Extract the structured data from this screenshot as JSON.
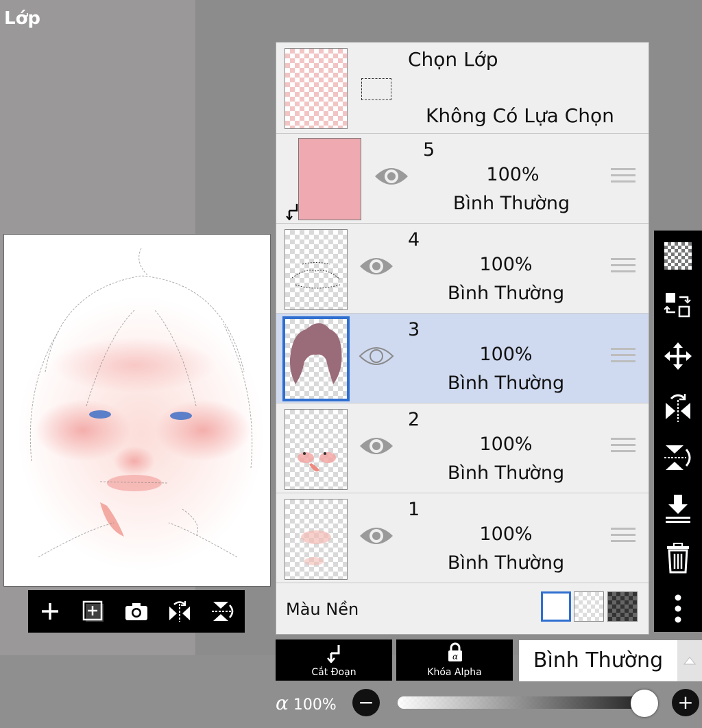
{
  "panel_title": "Lớp",
  "selection": {
    "title": "Chọn Lớp",
    "status": "Không Có Lựa Chọn"
  },
  "layers": [
    {
      "number": "5",
      "opacity": "100%",
      "blend": "Bình Thường",
      "clipped": true,
      "visible": true,
      "selected": false
    },
    {
      "number": "4",
      "opacity": "100%",
      "blend": "Bình Thường",
      "clipped": false,
      "visible": true,
      "selected": false
    },
    {
      "number": "3",
      "opacity": "100%",
      "blend": "Bình Thường",
      "clipped": false,
      "visible": false,
      "selected": true
    },
    {
      "number": "2",
      "opacity": "100%",
      "blend": "Bình Thường",
      "clipped": false,
      "visible": true,
      "selected": false
    },
    {
      "number": "1",
      "opacity": "100%",
      "blend": "Bình Thường",
      "clipped": false,
      "visible": true,
      "selected": false
    }
  ],
  "background": {
    "label": "Màu Nền",
    "options": [
      "white",
      "transparent",
      "dark-checker"
    ],
    "selected": "white"
  },
  "bottom_bar": {
    "clip_label": "Cắt Đoạn",
    "alpha_lock_label": "Khóa Alpha",
    "blend_mode": "Bình Thường",
    "alpha_symbol": "α",
    "opacity": "100%",
    "opacity_fraction": 1.0
  },
  "preview_toolbar": [
    "add-layer-icon",
    "add-layer-copy-icon",
    "camera-icon",
    "flip-horizontal-icon",
    "flip-vertical-icon"
  ],
  "side_toolbar": [
    "checker-icon",
    "transfer-icon",
    "move-icon",
    "flip-horizontal-icon",
    "flip-vertical-icon",
    "merge-down-icon",
    "trash-icon",
    "more-icon"
  ],
  "colors": {
    "selected_row": "#cfdaf0",
    "selected_border": "#2f6fd0",
    "layer5_fill": "#eeaab0",
    "layer3_hair": "#9a6b78"
  }
}
